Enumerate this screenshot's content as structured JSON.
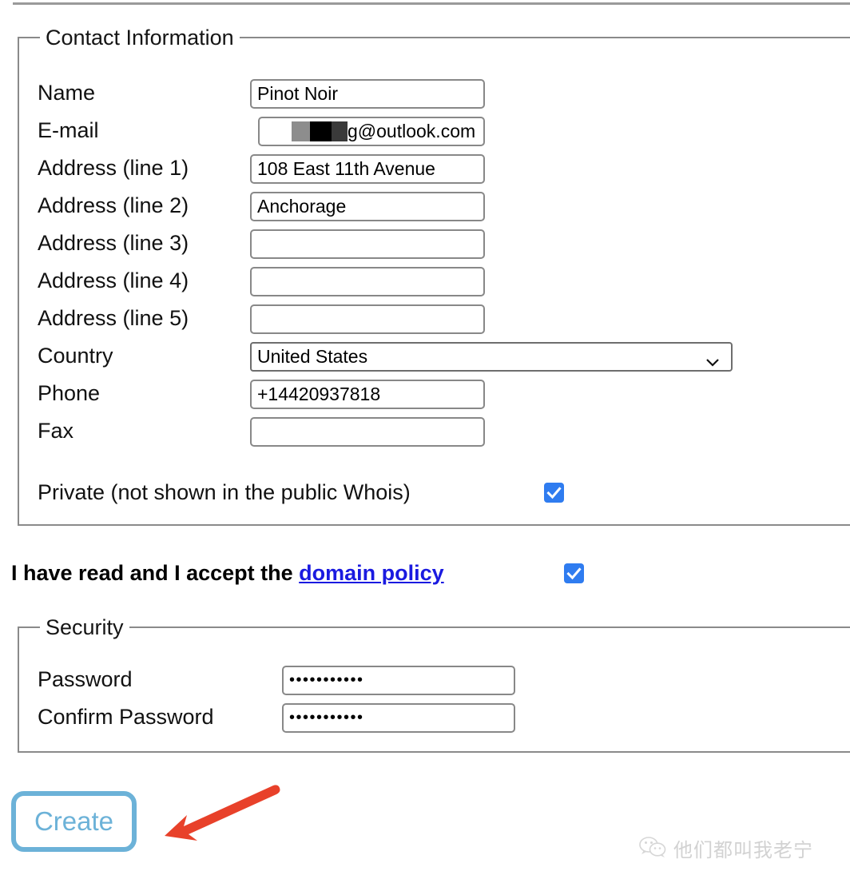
{
  "page": {
    "background": "#ffffff",
    "accent_blue": "#2f7cf0",
    "link_blue": "#1a1ae0",
    "button_blue": "#6cb2d8",
    "arrow_red": "#e8412a"
  },
  "contact_section": {
    "legend": "Contact Information",
    "fields": [
      {
        "label": "Name",
        "value": "Pinot Noir",
        "type": "text"
      },
      {
        "label": "E-mail",
        "value": "g@outlook.com",
        "type": "text-redacted"
      },
      {
        "label": "Address (line 1)",
        "value": "108 East 11th Avenue",
        "type": "text"
      },
      {
        "label": "Address (line 2)",
        "value": "Anchorage",
        "type": "text"
      },
      {
        "label": "Address (line 3)",
        "value": "",
        "type": "text"
      },
      {
        "label": "Address (line 4)",
        "value": "",
        "type": "text"
      },
      {
        "label": "Address (line 5)",
        "value": "",
        "type": "text"
      },
      {
        "label": "Country",
        "value": "United States",
        "type": "select"
      },
      {
        "label": "Phone",
        "value": "+14420937818",
        "type": "text"
      },
      {
        "label": "Fax",
        "value": "",
        "type": "text"
      }
    ],
    "private_checkbox": {
      "label": "Private (not shown in the public Whois)",
      "checked": true
    }
  },
  "accept_policy": {
    "text_before": "I have read and I accept the",
    "link_text": "domain policy",
    "checked": true
  },
  "security_section": {
    "legend": "Security",
    "fields": [
      {
        "label": "Password",
        "value": "•••••••••••"
      },
      {
        "label": "Confirm Password",
        "value": "•••••••••••"
      }
    ]
  },
  "create_button": {
    "label": "Create"
  },
  "annotation": {
    "arrow": "left-arrow-red"
  },
  "watermark": {
    "icon": "wechat-icon",
    "text": "他们都叫我老宁"
  }
}
